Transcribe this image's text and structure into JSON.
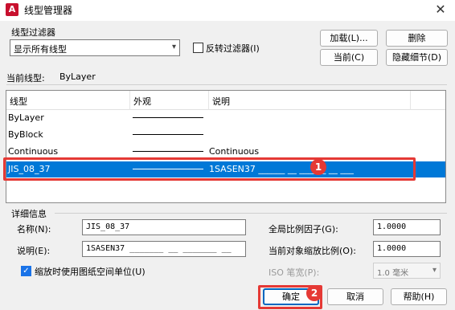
{
  "window": {
    "app_icon_letter": "A",
    "title": "线型管理器",
    "close_glyph": "✕"
  },
  "filter": {
    "group_label": "线型过滤器",
    "selected": "显示所有线型",
    "invert_label": "反转过滤器(I)",
    "invert_checked": false
  },
  "buttons": {
    "load": "加载(L)...",
    "delete": "删除",
    "current": "当前(C)",
    "hide_details": "隐藏细节(D)",
    "ok": "确定",
    "cancel": "取消",
    "help": "帮助(H)"
  },
  "current_linetype": {
    "label": "当前线型:",
    "value": "ByLayer"
  },
  "list": {
    "headers": [
      "线型",
      "外观",
      "说明"
    ],
    "rows": [
      {
        "name": "ByLayer",
        "description": "",
        "selected": false
      },
      {
        "name": "ByBlock",
        "description": "",
        "selected": false
      },
      {
        "name": "Continuous",
        "description": "Continuous",
        "selected": false
      },
      {
        "name": "JIS_08_37",
        "description": "1SASEN37 ______ __ ______ __ ___",
        "selected": true
      }
    ]
  },
  "details": {
    "group_label": "详细信息",
    "name_label": "名称(N):",
    "name_value": "JIS_08_37",
    "desc_label": "说明(E):",
    "desc_value": "1SASEN37 _______ __ _______ __",
    "global_scale_label": "全局比例因子(G):",
    "global_scale_value": "1.0000",
    "current_scale_label": "当前对象缩放比例(O):",
    "current_scale_value": "1.0000",
    "paper_units_label": "缩放时使用图纸空间单位(U)",
    "paper_units_checked": true,
    "iso_pen_label": "ISO 笔宽(P):",
    "iso_pen_value": "1.0 毫米"
  },
  "annotations": {
    "badge1": "1",
    "badge2": "2",
    "highlight_color": "#e53935"
  },
  "colors": {
    "selection": "#0078d7",
    "accent": "#0067c0"
  }
}
